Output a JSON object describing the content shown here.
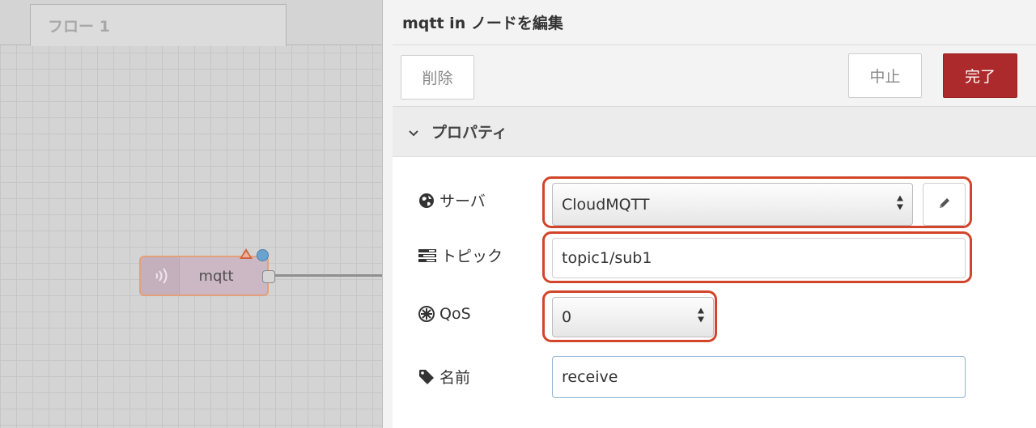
{
  "workspace": {
    "flow_tab_label": "フロー 1",
    "node": {
      "label": "mqtt",
      "icon": "wifi-broadcast-icon",
      "warning_icon": "warning-triangle-icon",
      "status_icon": "status-dot-icon",
      "fill_color": "#cbb8c4",
      "border_color": "#e3a07a"
    }
  },
  "panel": {
    "title": "mqtt in ノードを編集",
    "buttons": {
      "delete_label": "削除",
      "cancel_label": "中止",
      "done_label": "完了"
    },
    "section": {
      "title": "プロパティ",
      "icon": "chevron-down-icon"
    },
    "fields": {
      "server": {
        "label": "サーバ",
        "icon": "globe-icon",
        "value": "CloudMQTT",
        "edit_icon": "pencil-icon"
      },
      "topic": {
        "label": "トピック",
        "icon": "tasks-icon",
        "value": "topic1/sub1"
      },
      "qos": {
        "label": "QoS",
        "icon": "empire-icon",
        "value": "0"
      },
      "name": {
        "label": "名前",
        "icon": "tag-icon",
        "value": "receive"
      }
    },
    "colors": {
      "done_button": "#ac2a2b",
      "highlight": "#d2452b"
    }
  }
}
